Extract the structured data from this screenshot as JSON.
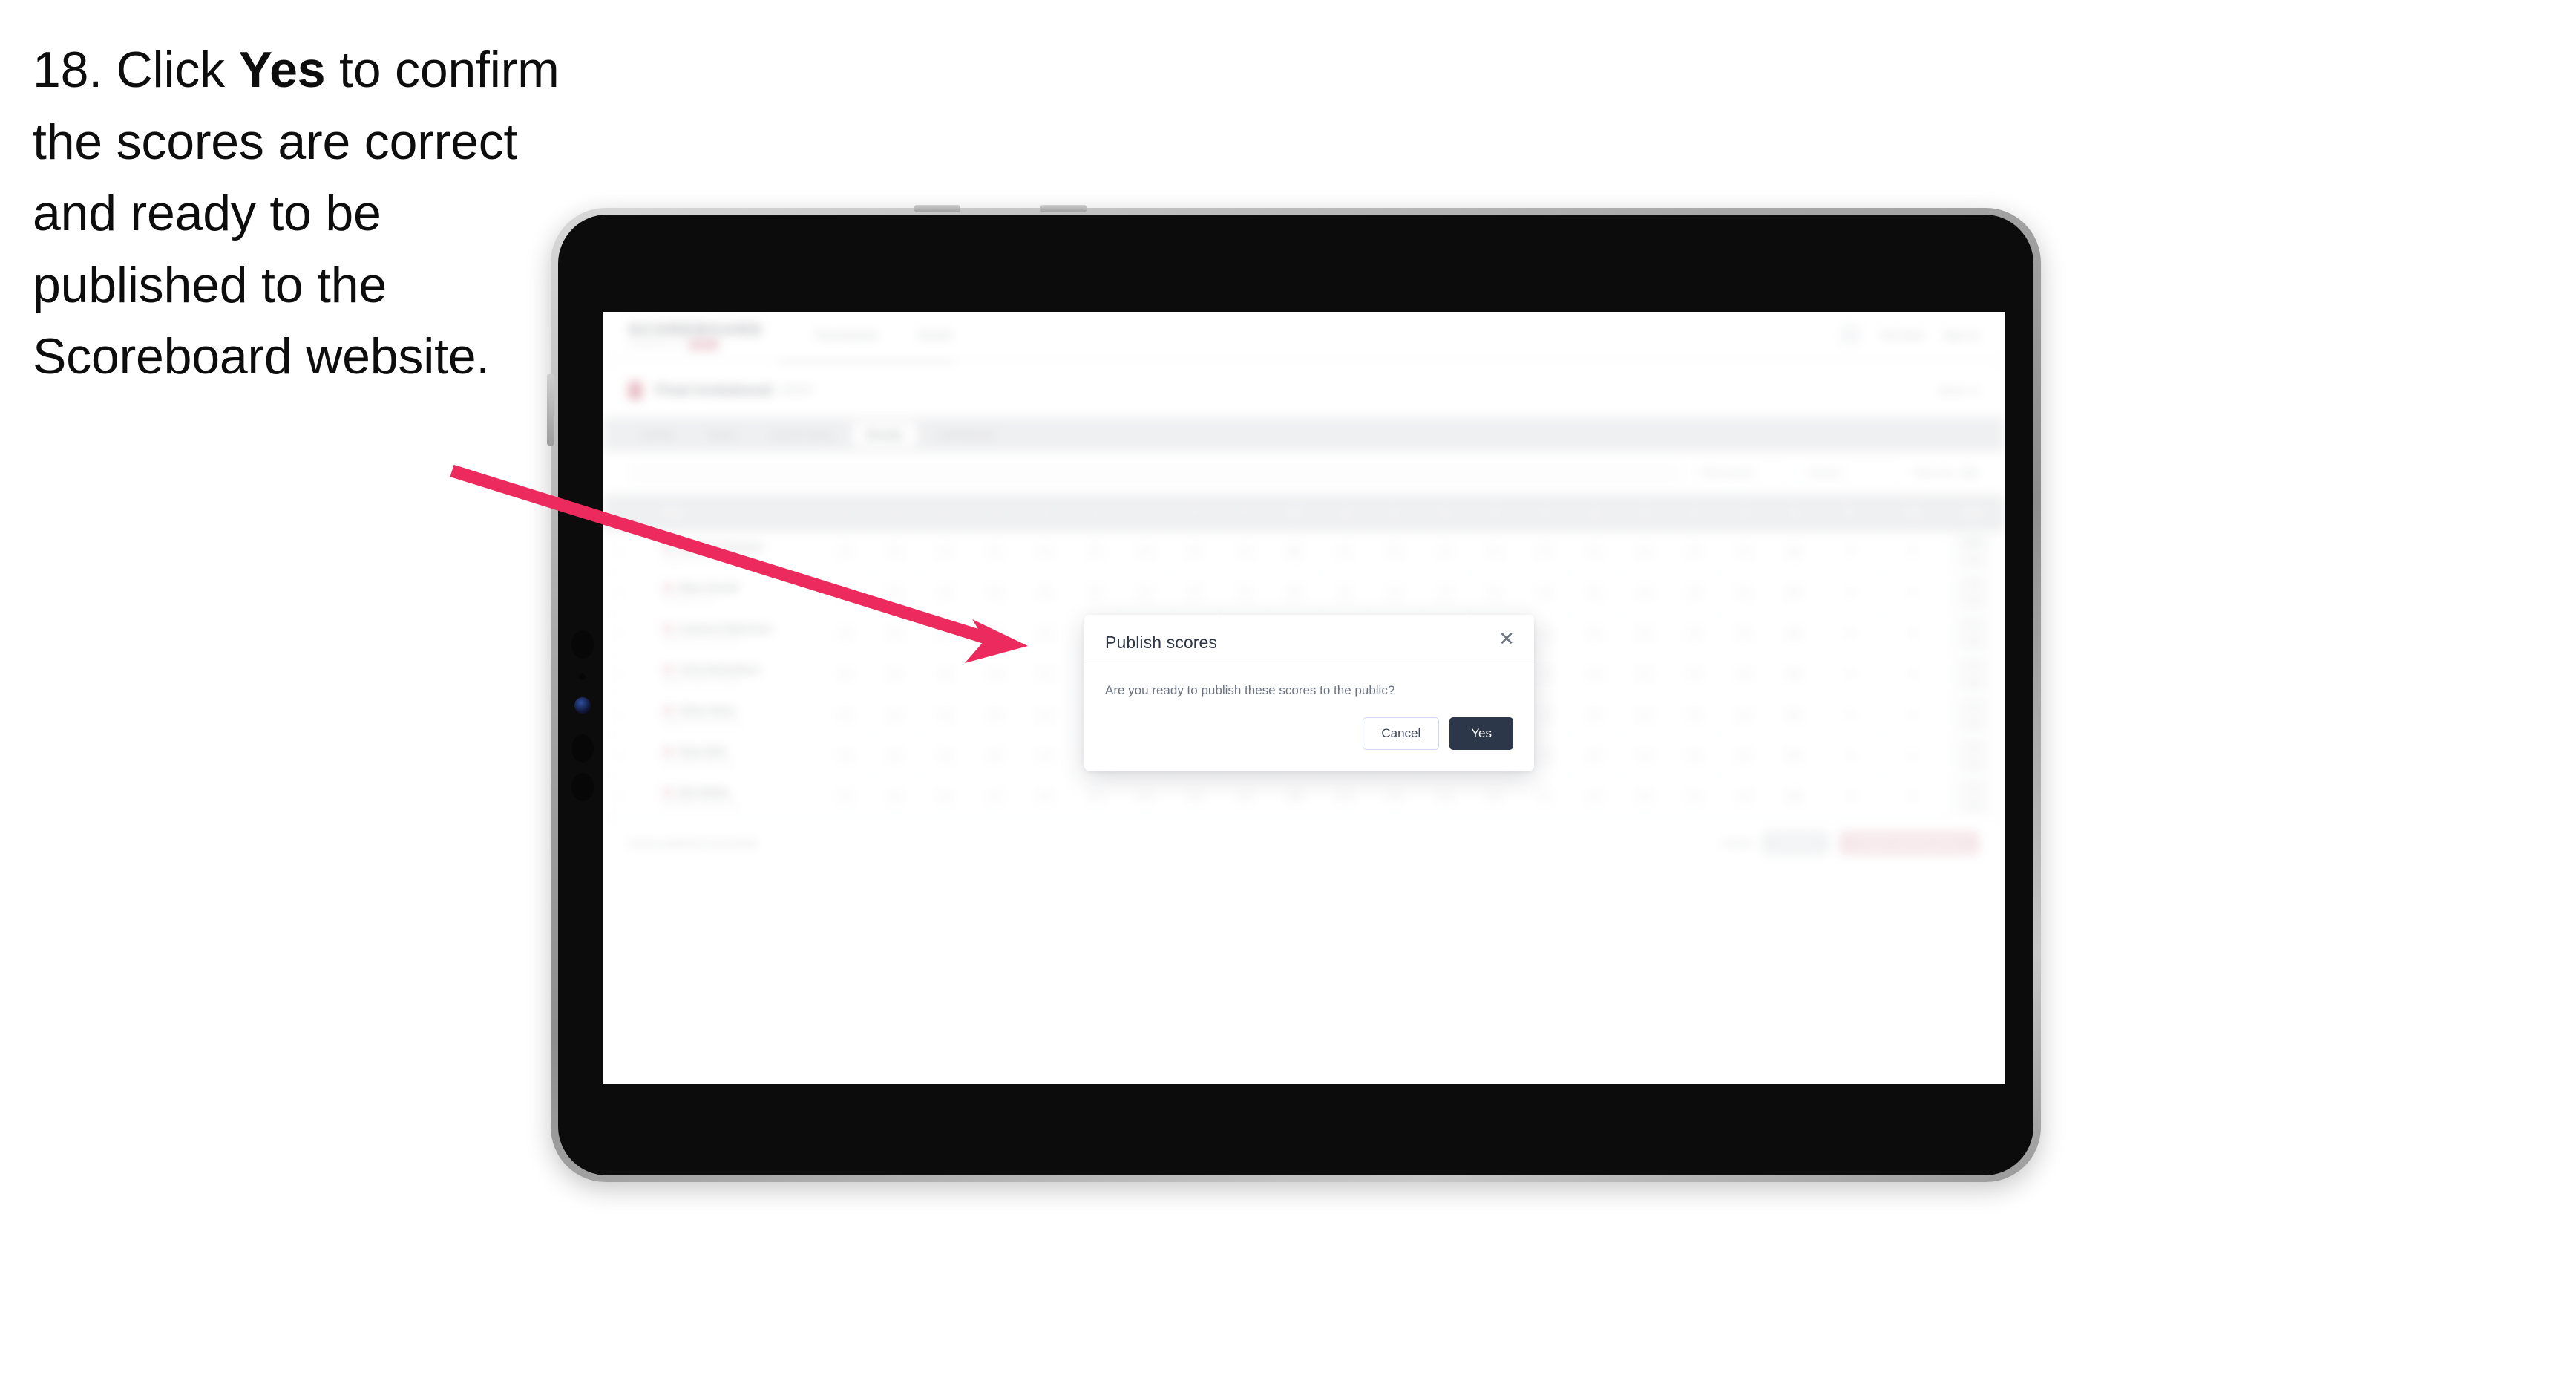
{
  "instruction": {
    "number": "18.",
    "lead": "Click",
    "emphasis": "Yes",
    "rest": "to confirm the scores are correct and ready to be published to the Scoreboard website."
  },
  "colors": {
    "arrow": "#ED2A5E",
    "primary_button": "#2C3749",
    "brand_accent": "#F5536F",
    "tablet_frame": "#9A9A9A",
    "bezel": "#0C0C0C"
  },
  "app": {
    "brand": {
      "name": "SCOREBOARD",
      "subtitle": "POWERED BY",
      "chip": "GOLF"
    },
    "nav": [
      "Tournaments",
      "Events"
    ],
    "account": {
      "icon": "user-avatar-icon",
      "user": "Tom Davis",
      "signout": "Sign out"
    },
    "event": {
      "flag_icon": "flag-icon",
      "name": "Final Invitational",
      "year": "2024",
      "right_label": "Week 12"
    },
    "tabs": [
      {
        "label": "Details",
        "active": false
      },
      {
        "label": "Teams",
        "active": false
      },
      {
        "label": "Course Setup",
        "active": false
      },
      {
        "label": "Results",
        "active": true
      },
      {
        "label": "Leaderboard",
        "active": false
      }
    ],
    "filters": {
      "search_placeholder": "Search players",
      "selects": [
        "Filter by team",
        "Round 1"
      ],
      "toggle_label": "Totals only"
    },
    "table": {
      "columns": [
        {
          "label": "",
          "type": "select"
        },
        {
          "label": "Player",
          "type": "player"
        },
        {
          "label": "1",
          "type": "hole"
        },
        {
          "label": "2",
          "type": "hole"
        },
        {
          "label": "3",
          "type": "hole"
        },
        {
          "label": "4",
          "type": "hole"
        },
        {
          "label": "5",
          "type": "hole"
        },
        {
          "label": "6",
          "type": "hole"
        },
        {
          "label": "7",
          "type": "hole"
        },
        {
          "label": "8",
          "type": "hole"
        },
        {
          "label": "9",
          "type": "hole"
        },
        {
          "label": "OUT",
          "type": "sub"
        },
        {
          "label": "10",
          "type": "hole"
        },
        {
          "label": "11",
          "type": "hole"
        },
        {
          "label": "12",
          "type": "hole"
        },
        {
          "label": "13",
          "type": "hole"
        },
        {
          "label": "14",
          "type": "hole"
        },
        {
          "label": "15",
          "type": "hole"
        },
        {
          "label": "16",
          "type": "hole"
        },
        {
          "label": "17",
          "type": "hole"
        },
        {
          "label": "18",
          "type": "hole"
        },
        {
          "label": "IN",
          "type": "sub"
        },
        {
          "label": "R1",
          "type": "round"
        },
        {
          "label": "Total",
          "type": "total"
        },
        {
          "label": "Status",
          "type": "status"
        }
      ],
      "rows": [
        {
          "player": "Spencer Thomsen",
          "club": "Oakdale Golf Club",
          "scores": [
            "4",
            "5",
            "3",
            "4",
            "4",
            "5",
            "4",
            "3",
            "4",
            "36",
            "4",
            "5",
            "4",
            "3",
            "5",
            "4",
            "4",
            "3",
            "4",
            "36"
          ],
          "r1": "72",
          "total": "72",
          "status": [
            "PAR",
            "72"
          ]
        },
        {
          "player": "Rhys Parnell",
          "club": "Crestview Links",
          "scores": [
            "5",
            "4",
            "4",
            "3",
            "5",
            "4",
            "4",
            "4",
            "4",
            "37",
            "5",
            "4",
            "3",
            "4",
            "4",
            "5",
            "4",
            "4",
            "4",
            "37"
          ],
          "r1": "74",
          "total": "74",
          "status": [
            "+2",
            "74"
          ]
        },
        {
          "player": "Cameron Robertson",
          "club": "Pinehurst Country Club",
          "scores": [
            "4",
            "4",
            "3",
            "5",
            "4",
            "4",
            "5",
            "3",
            "4",
            "36",
            "4",
            "4",
            "4",
            "4",
            "5",
            "4",
            "3",
            "4",
            "5",
            "37"
          ],
          "r1": "73",
          "total": "73",
          "status": [
            "+1",
            "73"
          ]
        },
        {
          "player": "Chris Richardson",
          "club": "Bayview Golf & Country",
          "scores": [
            "4",
            "5",
            "4",
            "4",
            "4",
            "5",
            "4",
            "4",
            "3",
            "37",
            "4",
            "5",
            "4",
            "4",
            "4",
            "4",
            "4",
            "4",
            "4",
            "37"
          ],
          "r1": "74",
          "total": "74",
          "status": [
            "+2",
            "74"
          ]
        },
        {
          "player": "Oliver Short",
          "club": "Highland Park Golf Club",
          "scores": [
            "5",
            "4",
            "4",
            "4",
            "5",
            "4",
            "4",
            "3",
            "4",
            "37",
            "5",
            "4",
            "4",
            "4",
            "4",
            "5",
            "4",
            "3",
            "4",
            "37"
          ],
          "r1": "74",
          "total": "74",
          "status": [
            "+2",
            "74"
          ]
        },
        {
          "player": "Ryan Britt",
          "club": "Riverstone Golf Links",
          "scores": [
            "4",
            "4",
            "4",
            "4",
            "4",
            "5",
            "5",
            "4",
            "4",
            "38",
            "4",
            "4",
            "5",
            "4",
            "4",
            "4",
            "4",
            "4",
            "4",
            "37"
          ],
          "r1": "75",
          "total": "75",
          "status": [
            "+3",
            "75"
          ]
        },
        {
          "player": "Ben Bailey",
          "club": "Sandhills Country Club",
          "scores": [
            "4",
            "5",
            "4",
            "4",
            "5",
            "4",
            "4",
            "4",
            "4",
            "38",
            "4",
            "4",
            "4",
            "5",
            "4",
            "4",
            "5",
            "4",
            "4",
            "38"
          ],
          "r1": "76",
          "total": "76",
          "status": [
            "+4",
            "76"
          ]
        }
      ]
    },
    "footer": {
      "note": "Scores published successfully",
      "link": "Cancel",
      "secondary": "Save all",
      "primary": "Publish and lock scores"
    }
  },
  "modal": {
    "title": "Publish scores",
    "close_icon": "close-icon",
    "body": "Are you ready to publish these scores to the public?",
    "cancel_label": "Cancel",
    "confirm_label": "Yes"
  }
}
